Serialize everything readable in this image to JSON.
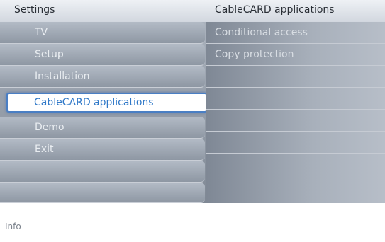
{
  "header": {
    "left_title": "Settings",
    "right_title": "CableCARD applications"
  },
  "menu": {
    "items": [
      {
        "label": "TV"
      },
      {
        "label": "Setup"
      },
      {
        "label": "Installation"
      },
      {
        "label": "CableCARD applications",
        "selected": true
      },
      {
        "label": "Demo"
      },
      {
        "label": "Exit"
      },
      {
        "label": ""
      },
      {
        "label": ""
      }
    ]
  },
  "submenu": {
    "items": [
      {
        "label": "Conditional access"
      },
      {
        "label": "Copy protection"
      },
      {
        "label": ""
      },
      {
        "label": ""
      },
      {
        "label": ""
      },
      {
        "label": ""
      },
      {
        "label": ""
      },
      {
        "label": ""
      }
    ]
  },
  "info": {
    "label": "Info"
  },
  "colors": {
    "selection_border": "#4a7fc4",
    "selection_text": "#2f78c8",
    "menu_text": "#e9edf1"
  }
}
